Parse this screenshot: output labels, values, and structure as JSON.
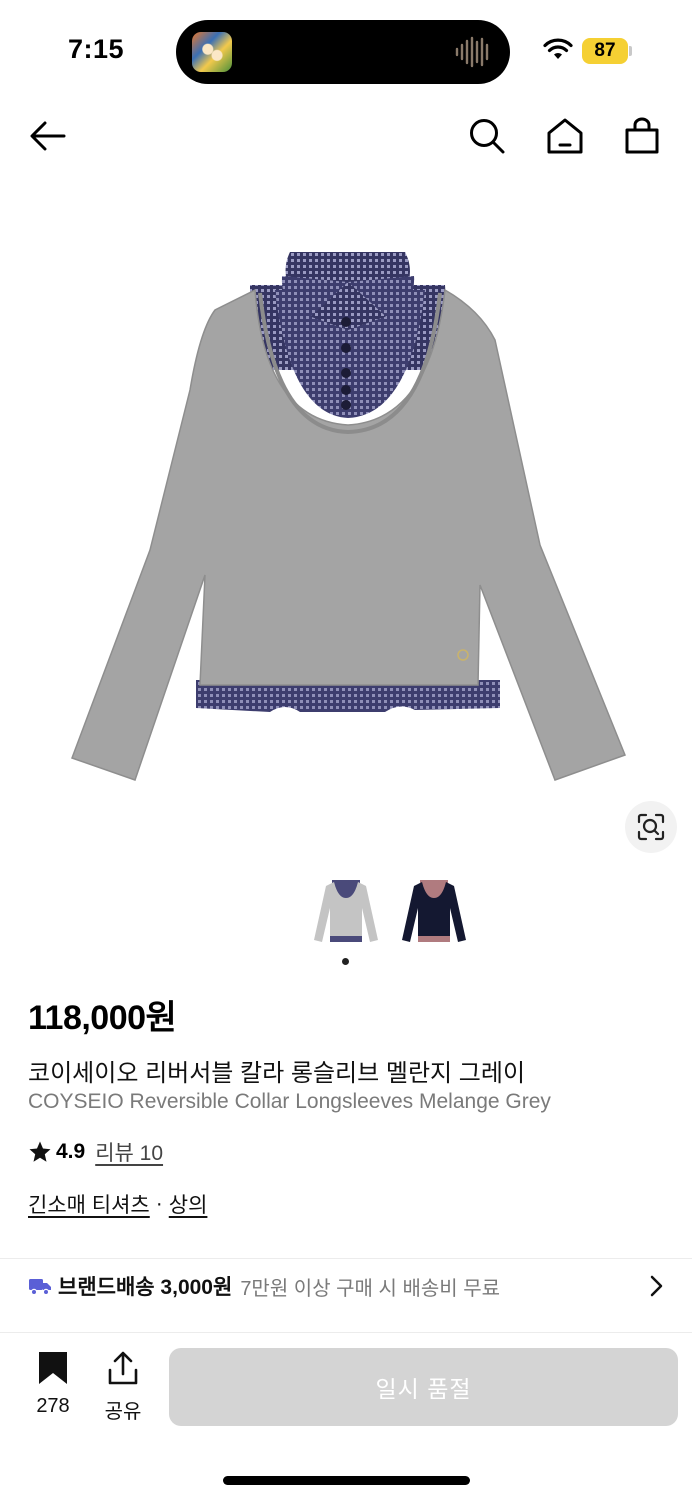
{
  "status": {
    "time": "7:15",
    "battery": "87"
  },
  "product": {
    "price": "118,000원",
    "name_ko": "코이세이오 리버서블 칼라 롱슬리브 멜란지 그레이",
    "name_en": "COYSEIO Reversible Collar Longsleeves Melange Grey",
    "rating": "4.9",
    "reviews_label": "리뷰 10",
    "category_1": "긴소매 티셔츠",
    "category_sep": "·",
    "category_2": "상의"
  },
  "shipping": {
    "label": "브랜드배송 3,000원",
    "note": "7만원 이상 구매 시 배송비 무료"
  },
  "bottom_bar": {
    "bookmark_count": "278",
    "share_label": "공유",
    "buy_label": "일시 품절"
  },
  "colors": {
    "accent_truck": "#5a5fd6",
    "disabled_button": "#d4d4d4",
    "battery": "#f5d033"
  },
  "icons": [
    "back-arrow-icon",
    "search-icon",
    "home-icon",
    "shopping-bag-icon",
    "visual-search-icon",
    "truck-icon",
    "chevron-right-icon",
    "bookmark-icon",
    "share-icon",
    "star-icon",
    "wifi-icon"
  ]
}
